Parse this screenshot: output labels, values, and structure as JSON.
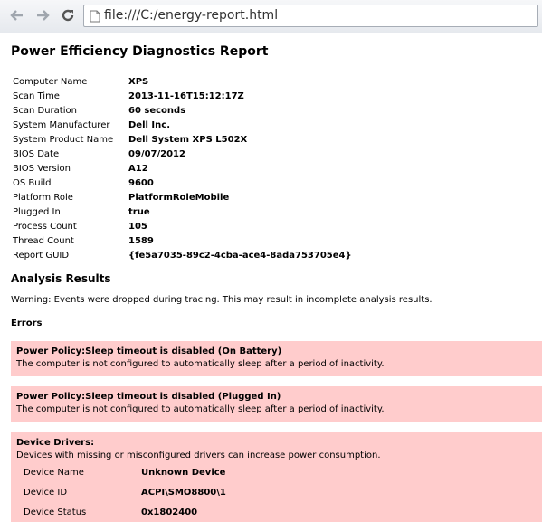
{
  "browser": {
    "url": "file:///C:/energy-report.html"
  },
  "report": {
    "title": "Power Efficiency Diagnostics Report",
    "info": [
      {
        "label": "Computer Name",
        "value": "XPS"
      },
      {
        "label": "Scan Time",
        "value": "2013-11-16T15:12:17Z"
      },
      {
        "label": "Scan Duration",
        "value": "60 seconds"
      },
      {
        "label": "System Manufacturer",
        "value": "Dell Inc."
      },
      {
        "label": "System Product Name",
        "value": "Dell System XPS L502X"
      },
      {
        "label": "BIOS Date",
        "value": "09/07/2012"
      },
      {
        "label": "BIOS Version",
        "value": "A12"
      },
      {
        "label": "OS Build",
        "value": "9600"
      },
      {
        "label": "Platform Role",
        "value": "PlatformRoleMobile"
      },
      {
        "label": "Plugged In",
        "value": "true"
      },
      {
        "label": "Process Count",
        "value": "105"
      },
      {
        "label": "Thread Count",
        "value": "1589"
      },
      {
        "label": "Report GUID",
        "value": "{fe5a7035-89c2-4cba-ace4-8ada753705e4}"
      }
    ],
    "analysis_title": "Analysis Results",
    "warning": "Warning: Events were dropped during tracing. This may result in incomplete analysis results.",
    "errors_title": "Errors",
    "errors": [
      {
        "title": "Power Policy:Sleep timeout is disabled (On Battery)",
        "desc": "The computer is not configured to automatically sleep after a period of inactivity."
      },
      {
        "title": "Power Policy:Sleep timeout is disabled (Plugged In)",
        "desc": "The computer is not configured to automatically sleep after a period of inactivity."
      }
    ],
    "drivers": {
      "title": "Device Drivers:",
      "desc": "Devices with missing or misconfigured drivers can increase power consumption.",
      "rows": [
        {
          "label": "Device Name",
          "value": "Unknown Device"
        },
        {
          "label": "Device ID",
          "value": "ACPI\\SMO8800\\1"
        },
        {
          "label": "Device Status",
          "value": "0x1802400"
        }
      ]
    }
  },
  "colors": {
    "error_bg": "#ffcccc"
  }
}
